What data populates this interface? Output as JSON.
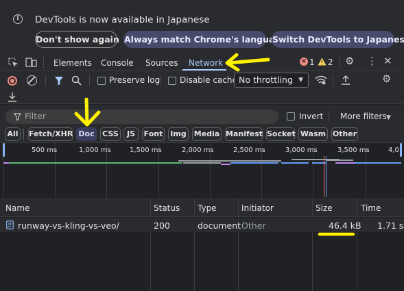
{
  "infobar": {
    "message": "DevTools is now available in Japanese",
    "buttons": [
      "Don't show again",
      "Always match Chrome's language",
      "Switch DevTools to Japanese"
    ]
  },
  "tabs": {
    "items": [
      "Elements",
      "Console",
      "Sources",
      "Network"
    ],
    "active": "Network",
    "error_count": "1",
    "warning_count": "2"
  },
  "toolbar": {
    "preserve_log": "Preserve log",
    "disable_cache": "Disable cache",
    "throttling": "No throttling"
  },
  "filter": {
    "placeholder": "Filter",
    "invert": "Invert",
    "more_filters": "More filters"
  },
  "type_filters": {
    "items": [
      "All",
      "Fetch/XHR",
      "Doc",
      "CSS",
      "JS",
      "Font",
      "Img",
      "Media",
      "Manifest",
      "Socket",
      "Wasm",
      "Other"
    ],
    "active": "Doc"
  },
  "overview": {
    "ticks": [
      "500 ms",
      "1,000 ms",
      "1,500 ms",
      "2,000 ms",
      "2,500 ms",
      "3,000 ms",
      "3,500 ms",
      "4,0"
    ]
  },
  "table": {
    "columns": [
      "Name",
      "Status",
      "Type",
      "Initiator",
      "Size",
      "Time"
    ],
    "rows": [
      {
        "name": "runway-vs-kling-vs-veo/",
        "status": "200",
        "type": "document",
        "initiator": "Other",
        "size": "46.4 kB",
        "time": "1.71 s"
      }
    ]
  },
  "colors": {
    "accent": "#a8c7fa",
    "annotation": "#fff200",
    "error": "#f28b82",
    "warning": "#fdd663"
  }
}
